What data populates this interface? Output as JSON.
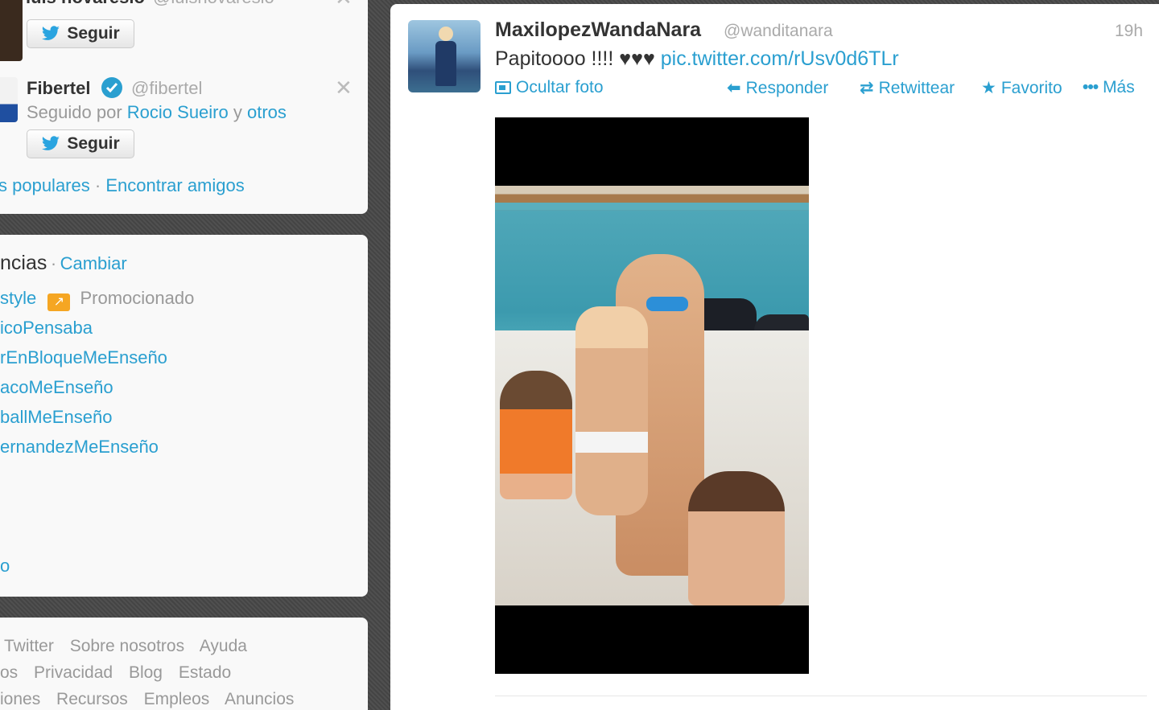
{
  "follow_suggestions": [
    {
      "name": "luis novaresio",
      "handle": "@luisnovaresio",
      "button": "Seguir"
    },
    {
      "name": "Fibertel",
      "handle": "@fibertel",
      "verified": true,
      "followed_by_prefix": "Seguido por",
      "followed_by_name": "Rocio Sueiro",
      "followed_by_suffix": "y",
      "followed_by_others": "otros",
      "button": "Seguir"
    }
  ],
  "follow_links": {
    "popular": "s populares",
    "separator": "·",
    "find_friends": "Encontrar amigos"
  },
  "trends": {
    "title": "ncias",
    "separator": "·",
    "change": "Cambiar",
    "items": [
      {
        "label": "style",
        "promoted": true,
        "promoted_label": "Promocionado"
      },
      {
        "label": "icoPensaba"
      },
      {
        "label": "rEnBloqueMeEnseño"
      },
      {
        "label": "acoMeEnseño"
      },
      {
        "label": "ballMeEnseño"
      },
      {
        "label": "ernandezMeEnseño"
      },
      {
        "label": "o"
      }
    ]
  },
  "footer": {
    "rows": [
      [
        "Twitter",
        "Sobre nosotros",
        "Ayuda"
      ],
      [
        "os",
        "Privacidad",
        "Blog",
        "Estado"
      ],
      [
        "iones",
        "Recursos",
        "Empleos",
        "Anuncios"
      ]
    ]
  },
  "tweet": {
    "name": "MaxilopezWandaNara",
    "handle": "@wanditanara",
    "time": "19h",
    "text": "Papitoooo !!!! ♥♥♥",
    "link": "pic.twitter.com/rUsv0d6TLr",
    "actions": {
      "hide_photo": "Ocultar foto",
      "reply": "Responder",
      "retweet": "Retwittear",
      "favorite": "Favorito",
      "more": "Más"
    }
  },
  "colors": {
    "link": "#2a9fd0",
    "muted": "#999999",
    "text": "#333333"
  }
}
